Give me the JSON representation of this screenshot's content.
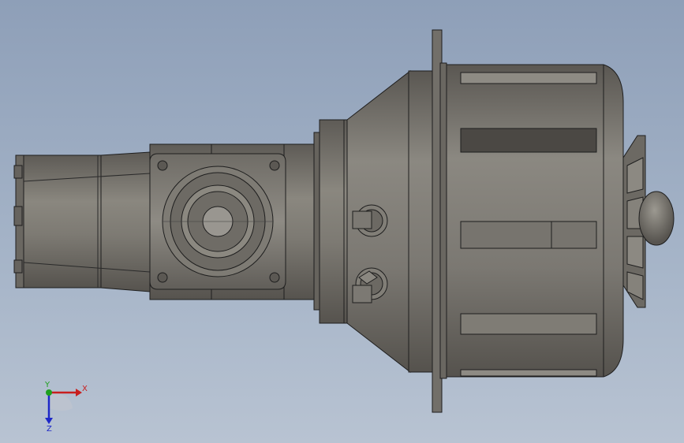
{
  "viewport": {
    "background_top": "#8e9fb8",
    "background_bottom": "#b8c3d2",
    "model_color": "#75726c",
    "edge_color": "#1e1e1e"
  },
  "triad": {
    "x_label": "X",
    "y_label": "Y",
    "z_label": "Z",
    "x_color": "#c81e1e",
    "y_color": "#1ea01e",
    "z_color": "#1e28c8"
  }
}
